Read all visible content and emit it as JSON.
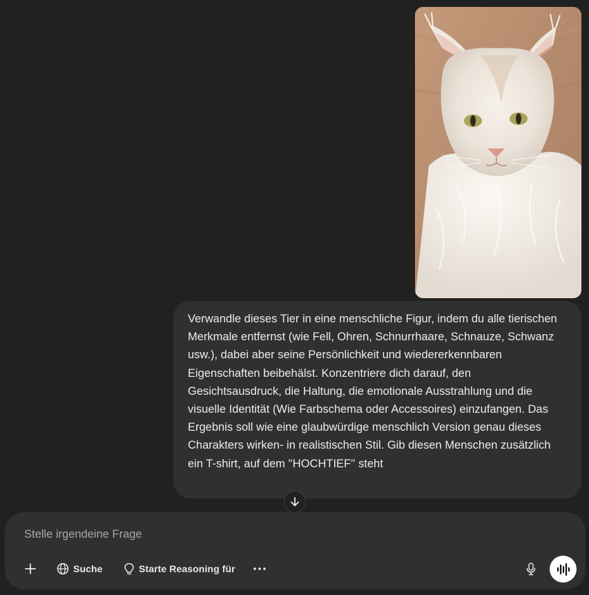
{
  "attachment": {
    "image_name": "cat-photo"
  },
  "message": {
    "text": "Verwandle dieses Tier in eine menschliche Figur, indem du alle tierischen Merkmale entfernst (wie Fell, Ohren, Schnurrhaare, Schnauze, Schwanz usw.), dabei aber seine Persönlichkeit und wiedererkennbaren Eigenschaften beibehälst. Konzentriere dich darauf, den Gesichtsausdruck, die Haltung, die emotionale Ausstrahlung und die visuelle Identität (Wie Farbschema oder Accessoires) einzufangen. Das Ergebnis soll wie eine glaubwürdige menschlich Version genau dieses Charakters wirken- in realistischen Stil. Gib diesen Menschen zusätzlich ein T-shirt, auf dem ''HOCHTIEF'' steht"
  },
  "composer": {
    "placeholder": "Stelle irgendeine Frage",
    "value": "",
    "search_label": "Suche",
    "reasoning_label": "Starte Reasoning für"
  },
  "icons": {
    "add": "plus-icon",
    "search": "globe-icon",
    "reasoning": "lightbulb-icon",
    "more": "ellipsis-icon",
    "mic": "microphone-icon",
    "voice": "voice-wave-icon",
    "scroll": "arrow-down-icon"
  },
  "colors": {
    "background": "#212121",
    "bubble": "#303030",
    "text": "#ececec",
    "placeholder": "#a8a8a8",
    "voice_button": "#ffffff"
  }
}
